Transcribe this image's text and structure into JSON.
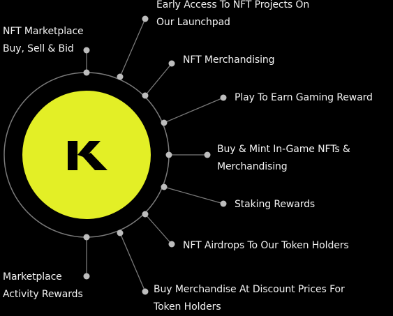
{
  "center_logo": {
    "letter": "K",
    "circle_color": "#e3ef26",
    "letter_color": "#000000"
  },
  "ring_color": "#7a7a7a",
  "dot_color": "#bdbdbd",
  "features": [
    {
      "lines": [
        "NFT Marketplace",
        "Buy, Sell & Bid"
      ]
    },
    {
      "lines": [
        "Early Access To NFT Projects On",
        "Our Launchpad"
      ]
    },
    {
      "lines": [
        "NFT Merchandising"
      ]
    },
    {
      "lines": [
        "Play To Earn Gaming Reward"
      ]
    },
    {
      "lines": [
        "Buy & Mint In-Game NFTs &",
        "Merchandising"
      ]
    },
    {
      "lines": [
        "Staking Rewards"
      ]
    },
    {
      "lines": [
        "NFT Airdrops To Our Token Holders"
      ]
    },
    {
      "lines": [
        "Buy Merchandise At Discount Prices For",
        "Token Holders"
      ]
    },
    {
      "lines": [
        "Marketplace",
        "Activity Rewards"
      ]
    }
  ]
}
